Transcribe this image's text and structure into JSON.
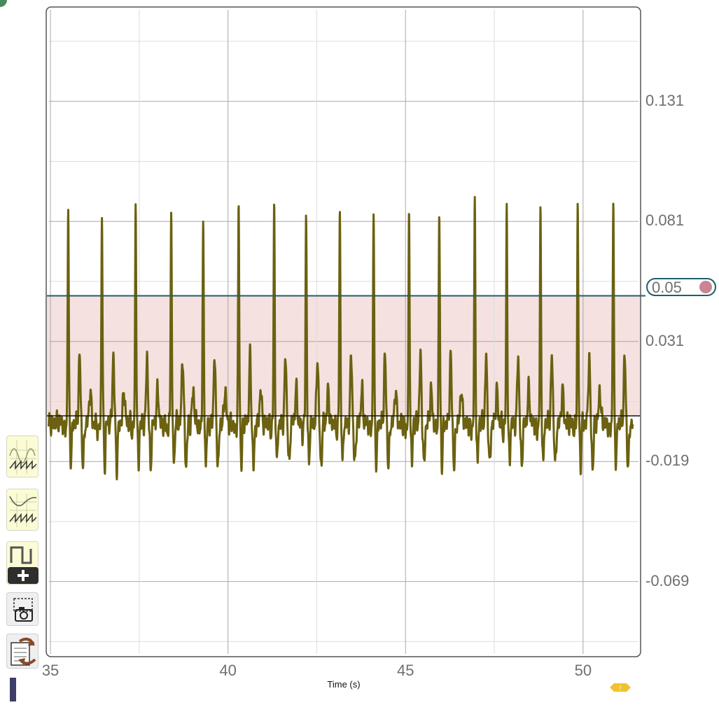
{
  "chart_data": {
    "type": "line",
    "xlabel": "Time (s)",
    "ylabel": "",
    "xlim": [
      34.9,
      51.6
    ],
    "ylim": [
      -0.1,
      0.17
    ],
    "x_ticks": [
      35,
      40,
      45,
      50
    ],
    "y_ticks": [
      0.131,
      0.081,
      0.031,
      -0.019,
      -0.069
    ],
    "y_tick_labels": [
      "0.131",
      "0.081",
      "0.031",
      "-0.019",
      "-0.069"
    ],
    "x_tick_labels": [
      "35",
      "40",
      "45",
      "50"
    ],
    "grid": true,
    "threshold": {
      "value": 0.05,
      "label": "0.05",
      "band": [
        0,
        0.05
      ],
      "band_color": "#f5e1df",
      "line_color": "#1f5f6a"
    },
    "baseline": 0.0,
    "series": [
      {
        "color": "#6b6110",
        "peaks": [
          {
            "x": 35.5,
            "y": 0.086
          },
          {
            "x": 36.45,
            "y": 0.084
          },
          {
            "x": 37.4,
            "y": 0.088
          },
          {
            "x": 38.4,
            "y": 0.087
          },
          {
            "x": 39.3,
            "y": 0.08
          },
          {
            "x": 40.3,
            "y": 0.087
          },
          {
            "x": 41.3,
            "y": 0.088
          },
          {
            "x": 42.2,
            "y": 0.084
          },
          {
            "x": 43.15,
            "y": 0.086
          },
          {
            "x": 44.1,
            "y": 0.085
          },
          {
            "x": 45.1,
            "y": 0.082
          },
          {
            "x": 45.95,
            "y": 0.085
          },
          {
            "x": 46.95,
            "y": 0.087
          },
          {
            "x": 47.85,
            "y": 0.086
          },
          {
            "x": 48.8,
            "y": 0.084
          },
          {
            "x": 49.85,
            "y": 0.086
          },
          {
            "x": 50.85,
            "y": 0.089
          }
        ],
        "x_end": 51.4
      }
    ]
  },
  "sidebar": {
    "tools": [
      {
        "name": "overlay-scope-icon"
      },
      {
        "name": "waveform-scope-icon"
      },
      {
        "name": "add-square-wave-icon"
      },
      {
        "name": "snapshot-camera-icon"
      },
      {
        "name": "refresh-document-icon"
      }
    ]
  },
  "colors": {
    "accent": "#1f5f6a",
    "trace": "#6b6110",
    "band": "#f5e1df",
    "handle": "#c98592",
    "warning": "#f2c12e"
  }
}
